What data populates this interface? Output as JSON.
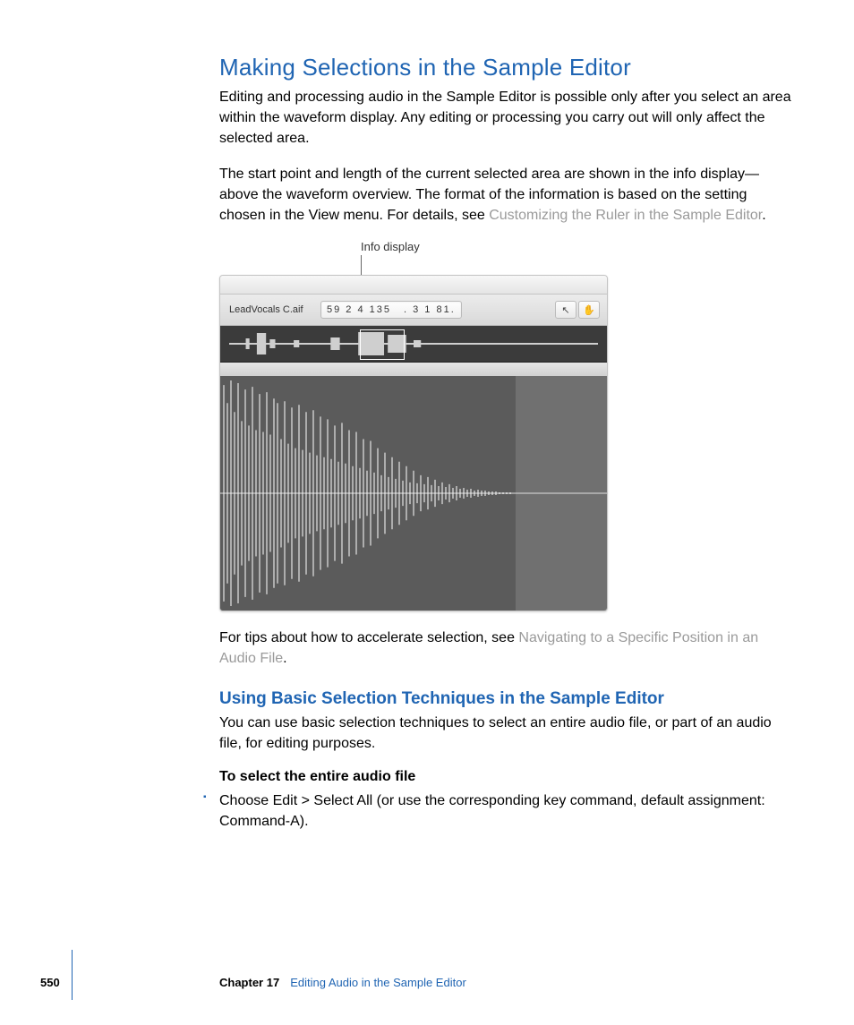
{
  "section": {
    "h1": "Making Selections in the Sample Editor",
    "p1": "Editing and processing audio in the Sample Editor is possible only after you select an area within the waveform display. Any editing or processing you carry out will only affect the selected area.",
    "p2a": "The start point and length of the current selected area are shown in the info display—above the waveform overview. The format of the information is based on the setting chosen in the View menu. For details, see ",
    "p2link": "Customizing the Ruler in the Sample Editor",
    "p2b": ".",
    "callout": "Info display",
    "p3a": "For tips about how to accelerate selection, see ",
    "p3link": "Navigating to a Specific Position in an Audio File",
    "p3b": "."
  },
  "sub": {
    "h2": "Using Basic Selection Techniques in the Sample Editor",
    "p1": "You can use basic selection techniques to select an entire audio file, or part of an audio file, for editing purposes.",
    "task": "To select the entire audio file",
    "step1": "Choose Edit > Select All (or use the corresponding key command, default assignment:  Command-A)."
  },
  "shot": {
    "filename": "LeadVocals C.aif",
    "info_group1": "59   2   4  135",
    "info_group2": ".   3   1   81.",
    "tool_arrow": "↖",
    "tool_hand": "✋"
  },
  "footer": {
    "page": "550",
    "chapter_label": "Chapter 17",
    "chapter_title": "Editing Audio in the Sample Editor"
  }
}
